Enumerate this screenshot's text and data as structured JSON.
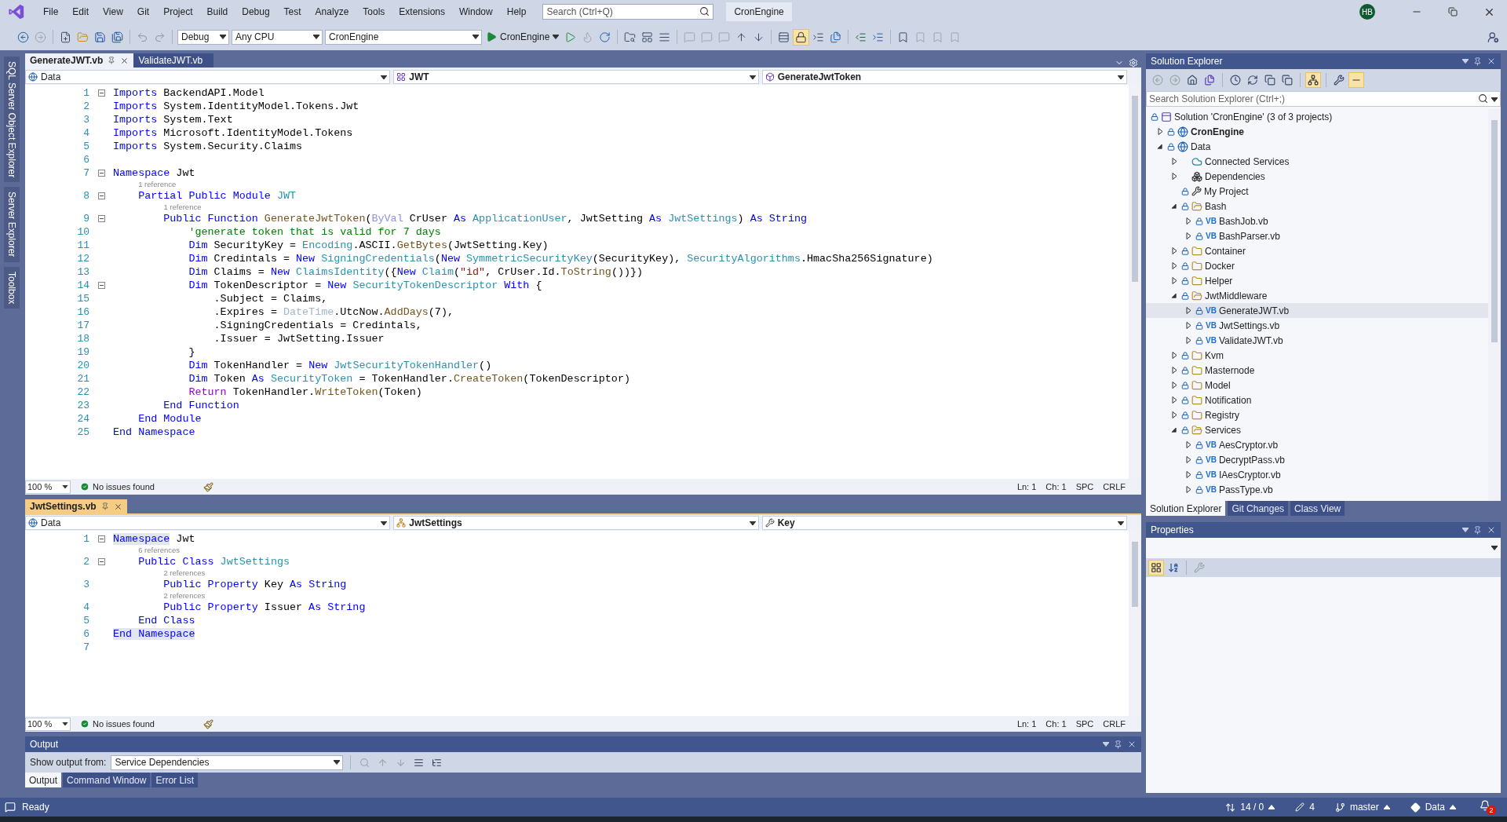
{
  "title_bar": {
    "menu": [
      "File",
      "Edit",
      "View",
      "Git",
      "Project",
      "Build",
      "Debug",
      "Test",
      "Analyze",
      "Tools",
      "Extensions",
      "Window",
      "Help"
    ],
    "search": {
      "placeholder": "Search (Ctrl+Q)"
    },
    "solution_name": "CronEngine",
    "avatar": "HB"
  },
  "toolbar": {
    "configuration": "Debug",
    "platform": "Any CPU",
    "startup_project": "CronEngine",
    "run_label": "CronEngine"
  },
  "side_tabs": [
    "SQL Server Object Explorer",
    "Server Explorer",
    "Toolbox"
  ],
  "editors": [
    {
      "active": false,
      "tabs": [
        {
          "label": "GenerateJWT.vb",
          "selected": true
        },
        {
          "label": "ValidateJWT.vb",
          "selected": false
        }
      ],
      "nav": [
        {
          "label": "Data",
          "kind": "project"
        },
        {
          "label": "JWT",
          "kind": "module"
        },
        {
          "label": "GenerateJwtToken",
          "kind": "method"
        }
      ],
      "lines": [
        {
          "n": "1",
          "fold": true,
          "tokens": [
            {
              "kind": "keyword",
              "text": "Imports"
            },
            {
              "kind": "plain",
              "text": " BackendAPI.Model"
            }
          ]
        },
        {
          "n": "2",
          "fold": false,
          "tokens": [
            {
              "kind": "keyword",
              "text": "Imports"
            },
            {
              "kind": "plain",
              "text": " System.IdentityModel.Tokens.Jwt"
            }
          ]
        },
        {
          "n": "3",
          "fold": false,
          "tokens": [
            {
              "kind": "keyword",
              "text": "Imports"
            },
            {
              "kind": "plain",
              "text": " System.Text"
            }
          ]
        },
        {
          "n": "4",
          "fold": false,
          "tokens": [
            {
              "kind": "keyword",
              "text": "Imports"
            },
            {
              "kind": "plain",
              "text": " Microsoft.IdentityModel.Tokens"
            }
          ]
        },
        {
          "n": "5",
          "fold": false,
          "tokens": [
            {
              "kind": "keyword",
              "text": "Imports"
            },
            {
              "kind": "plain",
              "text": " System.Security.Claims"
            }
          ]
        },
        {
          "n": "6",
          "fold": false
        },
        {
          "n": "7",
          "fold": true,
          "tokens": [
            {
              "kind": "keyword",
              "text": "Namespace"
            },
            {
              "kind": "plain",
              "text": " Jwt"
            }
          ]
        },
        {
          "n": "8",
          "fold": true,
          "lens": "1 reference",
          "tokens": [
            {
              "kind": "keyword",
              "text": "    Partial Public Module"
            },
            {
              "kind": "type",
              "text": " JWT"
            }
          ]
        },
        {
          "n": "9",
          "fold": true,
          "lens": "1 reference",
          "tokens": [
            {
              "kind": "keyword",
              "text": "        Public Function"
            },
            {
              "kind": "method",
              "text": " GenerateJwtToken"
            },
            {
              "kind": "plain",
              "text": "("
            },
            {
              "kind": "faded",
              "text": "ByVal"
            },
            {
              "kind": "plain",
              "text": " CrUser"
            },
            {
              "kind": "keyword",
              "text": " As"
            },
            {
              "kind": "type",
              "text": " ApplicationUser"
            },
            {
              "kind": "plain",
              "text": ", JwtSetting"
            },
            {
              "kind": "keyword",
              "text": " As"
            },
            {
              "kind": "type",
              "text": " JwtSettings"
            },
            {
              "kind": "plain",
              "text": ")"
            },
            {
              "kind": "keyword",
              "text": " As String"
            }
          ]
        },
        {
          "n": "10",
          "fold": false,
          "tokens": [
            {
              "kind": "comment",
              "text": "            'generate token that is valid for 7 days"
            }
          ]
        },
        {
          "n": "11",
          "fold": false,
          "tokens": [
            {
              "kind": "keyword",
              "text": "            Dim"
            },
            {
              "kind": "plain",
              "text": " SecurityKey = "
            },
            {
              "kind": "type",
              "text": "Encoding"
            },
            {
              "kind": "plain",
              "text": ".ASCII."
            },
            {
              "kind": "method",
              "text": "GetBytes"
            },
            {
              "kind": "plain",
              "text": "(JwtSetting.Key)"
            }
          ]
        },
        {
          "n": "12",
          "fold": false,
          "tokens": [
            {
              "kind": "keyword",
              "text": "            Dim"
            },
            {
              "kind": "plain",
              "text": " Credintals = "
            },
            {
              "kind": "keyword",
              "text": "New"
            },
            {
              "kind": "type",
              "text": " SigningCredentials"
            },
            {
              "kind": "plain",
              "text": "("
            },
            {
              "kind": "keyword",
              "text": "New"
            },
            {
              "kind": "type",
              "text": " SymmetricSecurityKey"
            },
            {
              "kind": "plain",
              "text": "(SecurityKey), "
            },
            {
              "kind": "type",
              "text": "SecurityAlgorithms"
            },
            {
              "kind": "plain",
              "text": ".HmacSha256Signature)"
            }
          ]
        },
        {
          "n": "13",
          "fold": false,
          "tokens": [
            {
              "kind": "keyword",
              "text": "            Dim"
            },
            {
              "kind": "plain",
              "text": " Claims = "
            },
            {
              "kind": "keyword",
              "text": "New"
            },
            {
              "kind": "type",
              "text": " ClaimsIdentity"
            },
            {
              "kind": "plain",
              "text": "({"
            },
            {
              "kind": "keyword",
              "text": "New"
            },
            {
              "kind": "type",
              "text": " Claim"
            },
            {
              "kind": "plain",
              "text": "("
            },
            {
              "kind": "string",
              "text": "\"id\""
            },
            {
              "kind": "plain",
              "text": ", CrUser.Id."
            },
            {
              "kind": "method",
              "text": "ToString"
            },
            {
              "kind": "plain",
              "text": "())})"
            }
          ]
        },
        {
          "n": "14",
          "fold": true,
          "tokens": [
            {
              "kind": "keyword",
              "text": "            Dim"
            },
            {
              "kind": "plain",
              "text": " TokenDescriptor = "
            },
            {
              "kind": "keyword",
              "text": "New"
            },
            {
              "kind": "type",
              "text": " SecurityTokenDescriptor"
            },
            {
              "kind": "keyword",
              "text": " With"
            },
            {
              "kind": "plain",
              "text": " {"
            }
          ]
        },
        {
          "n": "15",
          "fold": false,
          "tokens": [
            {
              "kind": "plain",
              "text": "                .Subject = Claims,"
            }
          ]
        },
        {
          "n": "16",
          "fold": false,
          "tokens": [
            {
              "kind": "plain",
              "text": "                .Expires = "
            },
            {
              "kind": "faded_type",
              "text": "DateTime"
            },
            {
              "kind": "plain",
              "text": ".UtcNow."
            },
            {
              "kind": "method",
              "text": "AddDays"
            },
            {
              "kind": "plain",
              "text": "(7),"
            }
          ]
        },
        {
          "n": "17",
          "fold": false,
          "tokens": [
            {
              "kind": "plain",
              "text": "                .SigningCredentials = Credintals,"
            }
          ]
        },
        {
          "n": "18",
          "fold": false,
          "tokens": [
            {
              "kind": "plain",
              "text": "                .Issuer = JwtSetting.Issuer"
            }
          ]
        },
        {
          "n": "19",
          "fold": false,
          "tokens": [
            {
              "kind": "plain",
              "text": "            }"
            }
          ]
        },
        {
          "n": "20",
          "fold": false,
          "tokens": [
            {
              "kind": "keyword",
              "text": "            Dim"
            },
            {
              "kind": "plain",
              "text": " TokenHandler = "
            },
            {
              "kind": "keyword",
              "text": "New"
            },
            {
              "kind": "type",
              "text": " JwtSecurityTokenHandler"
            },
            {
              "kind": "plain",
              "text": "()"
            }
          ]
        },
        {
          "n": "21",
          "fold": false,
          "tokens": [
            {
              "kind": "keyword",
              "text": "            Dim"
            },
            {
              "kind": "plain",
              "text": " Token"
            },
            {
              "kind": "keyword",
              "text": " As"
            },
            {
              "kind": "type",
              "text": " SecurityToken"
            },
            {
              "kind": "plain",
              "text": " = TokenHandler."
            },
            {
              "kind": "method",
              "text": "CreateToken"
            },
            {
              "kind": "plain",
              "text": "(TokenDescriptor)"
            }
          ]
        },
        {
          "n": "22",
          "fold": false,
          "tokens": [
            {
              "kind": "control",
              "text": "            Return"
            },
            {
              "kind": "plain",
              "text": " TokenHandler."
            },
            {
              "kind": "method",
              "text": "WriteToken"
            },
            {
              "kind": "plain",
              "text": "(Token)"
            }
          ]
        },
        {
          "n": "23",
          "fold": false,
          "tokens": [
            {
              "kind": "keyword",
              "text": "        End Function"
            }
          ]
        },
        {
          "n": "24",
          "fold": false,
          "tokens": [
            {
              "kind": "keyword",
              "text": "    End Module"
            }
          ]
        },
        {
          "n": "25",
          "fold": false,
          "tokens": [
            {
              "kind": "keyword",
              "text": "End Namespace"
            }
          ]
        }
      ],
      "status": {
        "zoom": "100 %",
        "issues": "No issues found",
        "line": "Ln: 1",
        "column": "Ch: 1",
        "whitespace": "SPC",
        "line_ending": "CRLF"
      }
    },
    {
      "active": true,
      "tabs": [
        {
          "label": "JwtSettings.vb",
          "selected": true
        }
      ],
      "nav": [
        {
          "label": "Data",
          "kind": "project"
        },
        {
          "label": "JwtSettings",
          "kind": "class"
        },
        {
          "label": "Key",
          "kind": "property"
        }
      ],
      "lines": [
        {
          "n": "1",
          "fold": true,
          "tokens": [
            {
              "kind": "keyword_highlight",
              "text": "Namespace"
            },
            {
              "kind": "plain",
              "text": " Jwt"
            }
          ]
        },
        {
          "n": "2",
          "fold": true,
          "lens": "6 references",
          "tokens": [
            {
              "kind": "keyword",
              "text": "    Public Class"
            },
            {
              "kind": "type",
              "text": " JwtSettings"
            }
          ]
        },
        {
          "n": "3",
          "fold": false,
          "lens": "2 references",
          "tokens": [
            {
              "kind": "keyword",
              "text": "        Public Property"
            },
            {
              "kind": "plain",
              "text": " Key"
            },
            {
              "kind": "keyword",
              "text": " As String"
            }
          ]
        },
        {
          "n": "4",
          "fold": false,
          "lens": "2 references",
          "tokens": [
            {
              "kind": "keyword",
              "text": "        Public Property"
            },
            {
              "kind": "plain",
              "text": " Issuer"
            },
            {
              "kind": "keyword",
              "text": " As String"
            }
          ]
        },
        {
          "n": "5",
          "fold": false,
          "tokens": [
            {
              "kind": "keyword",
              "text": "    End Class"
            }
          ]
        },
        {
          "n": "6",
          "fold": false,
          "tokens": [
            {
              "kind": "keyword_highlight",
              "text": "End Namespace"
            }
          ]
        },
        {
          "n": "7",
          "fold": false
        }
      ],
      "status": {
        "zoom": "100 %",
        "issues": "No issues found",
        "line": "Ln: 1",
        "column": "Ch: 1",
        "whitespace": "SPC",
        "line_ending": "CRLF"
      }
    }
  ],
  "output": {
    "title": "Output",
    "source_label": "Show output from:",
    "source": "Service Dependencies",
    "tabs": [
      {
        "label": "Output",
        "selected": true
      },
      {
        "label": "Command Window",
        "selected": false
      },
      {
        "label": "Error List",
        "selected": false
      }
    ]
  },
  "solution_explorer": {
    "title": "Solution Explorer",
    "search": {
      "placeholder": "Search Solution Explorer (Ctrl+;)"
    },
    "tree": [
      {
        "label": "Solution 'CronEngine' (3 of 3 projects)",
        "kind": "solution",
        "locked": true,
        "selected": false,
        "children": [
          {
            "label": "CronEngine",
            "kind": "startup_project",
            "locked": true,
            "expanded": false,
            "selected": false
          },
          {
            "label": "Data",
            "kind": "project",
            "locked": true,
            "expanded": true,
            "selected": false,
            "children": [
              {
                "label": "Connected Services",
                "kind": "connected",
                "locked": false,
                "expanded": false,
                "selected": false
              },
              {
                "label": "Dependencies",
                "kind": "dependencies",
                "locked": false,
                "expanded": false,
                "selected": false
              },
              {
                "label": "My Project",
                "kind": "myproject",
                "locked": true,
                "selected": false
              },
              {
                "label": "Bash",
                "kind": "folder",
                "locked": true,
                "expanded": true,
                "selected": false,
                "children": [
                  {
                    "label": "BashJob.vb",
                    "kind": "file",
                    "badge": "VB",
                    "locked": true,
                    "expanded": false,
                    "selected": false
                  },
                  {
                    "label": "BashParser.vb",
                    "kind": "file",
                    "badge": "VB",
                    "locked": true,
                    "expanded": false,
                    "selected": false
                  }
                ]
              },
              {
                "label": "Container",
                "kind": "folder",
                "locked": true,
                "expanded": false,
                "selected": false
              },
              {
                "label": "Docker",
                "kind": "folder",
                "locked": true,
                "expanded": false,
                "selected": false
              },
              {
                "label": "Helper",
                "kind": "folder",
                "locked": true,
                "expanded": false,
                "selected": false
              },
              {
                "label": "JwtMiddleware",
                "kind": "folder",
                "locked": true,
                "expanded": true,
                "selected": false,
                "children": [
                  {
                    "label": "GenerateJWT.vb",
                    "kind": "file",
                    "badge": "VB",
                    "locked": true,
                    "expanded": false,
                    "selected": true
                  },
                  {
                    "label": "JwtSettings.vb",
                    "kind": "file",
                    "badge": "VB",
                    "locked": true,
                    "expanded": false,
                    "selected": false
                  },
                  {
                    "label": "ValidateJWT.vb",
                    "kind": "file",
                    "badge": "VB",
                    "locked": true,
                    "expanded": false,
                    "selected": false
                  }
                ]
              },
              {
                "label": "Kvm",
                "kind": "folder",
                "locked": true,
                "expanded": false,
                "selected": false
              },
              {
                "label": "Masternode",
                "kind": "folder",
                "locked": true,
                "expanded": false,
                "selected": false
              },
              {
                "label": "Model",
                "kind": "folder",
                "locked": true,
                "expanded": false,
                "selected": false
              },
              {
                "label": "Notification",
                "kind": "folder",
                "locked": true,
                "expanded": false,
                "selected": false
              },
              {
                "label": "Registry",
                "kind": "folder",
                "locked": true,
                "expanded": false,
                "selected": false
              },
              {
                "label": "Services",
                "kind": "folder",
                "locked": true,
                "expanded": true,
                "selected": false,
                "children": [
                  {
                    "label": "AesCryptor.vb",
                    "kind": "file",
                    "badge": "VB",
                    "locked": true,
                    "expanded": false,
                    "selected": false
                  },
                  {
                    "label": "DecryptPass.vb",
                    "kind": "file",
                    "badge": "VB",
                    "locked": true,
                    "expanded": false,
                    "selected": false
                  },
                  {
                    "label": "IAesCryptor.vb",
                    "kind": "file",
                    "badge": "VB",
                    "locked": true,
                    "expanded": false,
                    "selected": false
                  },
                  {
                    "label": "PassType.vb",
                    "kind": "file",
                    "badge": "VB",
                    "locked": true,
                    "expanded": false,
                    "selected": false
                  }
                ]
              }
            ]
          }
        ]
      }
    ],
    "tabs": [
      {
        "label": "Solution Explorer",
        "selected": true
      },
      {
        "label": "Git Changes",
        "selected": false
      },
      {
        "label": "Class View",
        "selected": false
      }
    ]
  },
  "properties": {
    "title": "Properties"
  },
  "status_bar": {
    "state": "Ready",
    "changes": "14 / 0",
    "edits": "4",
    "branch": "master",
    "repository": "Data",
    "notifications": "2"
  }
}
